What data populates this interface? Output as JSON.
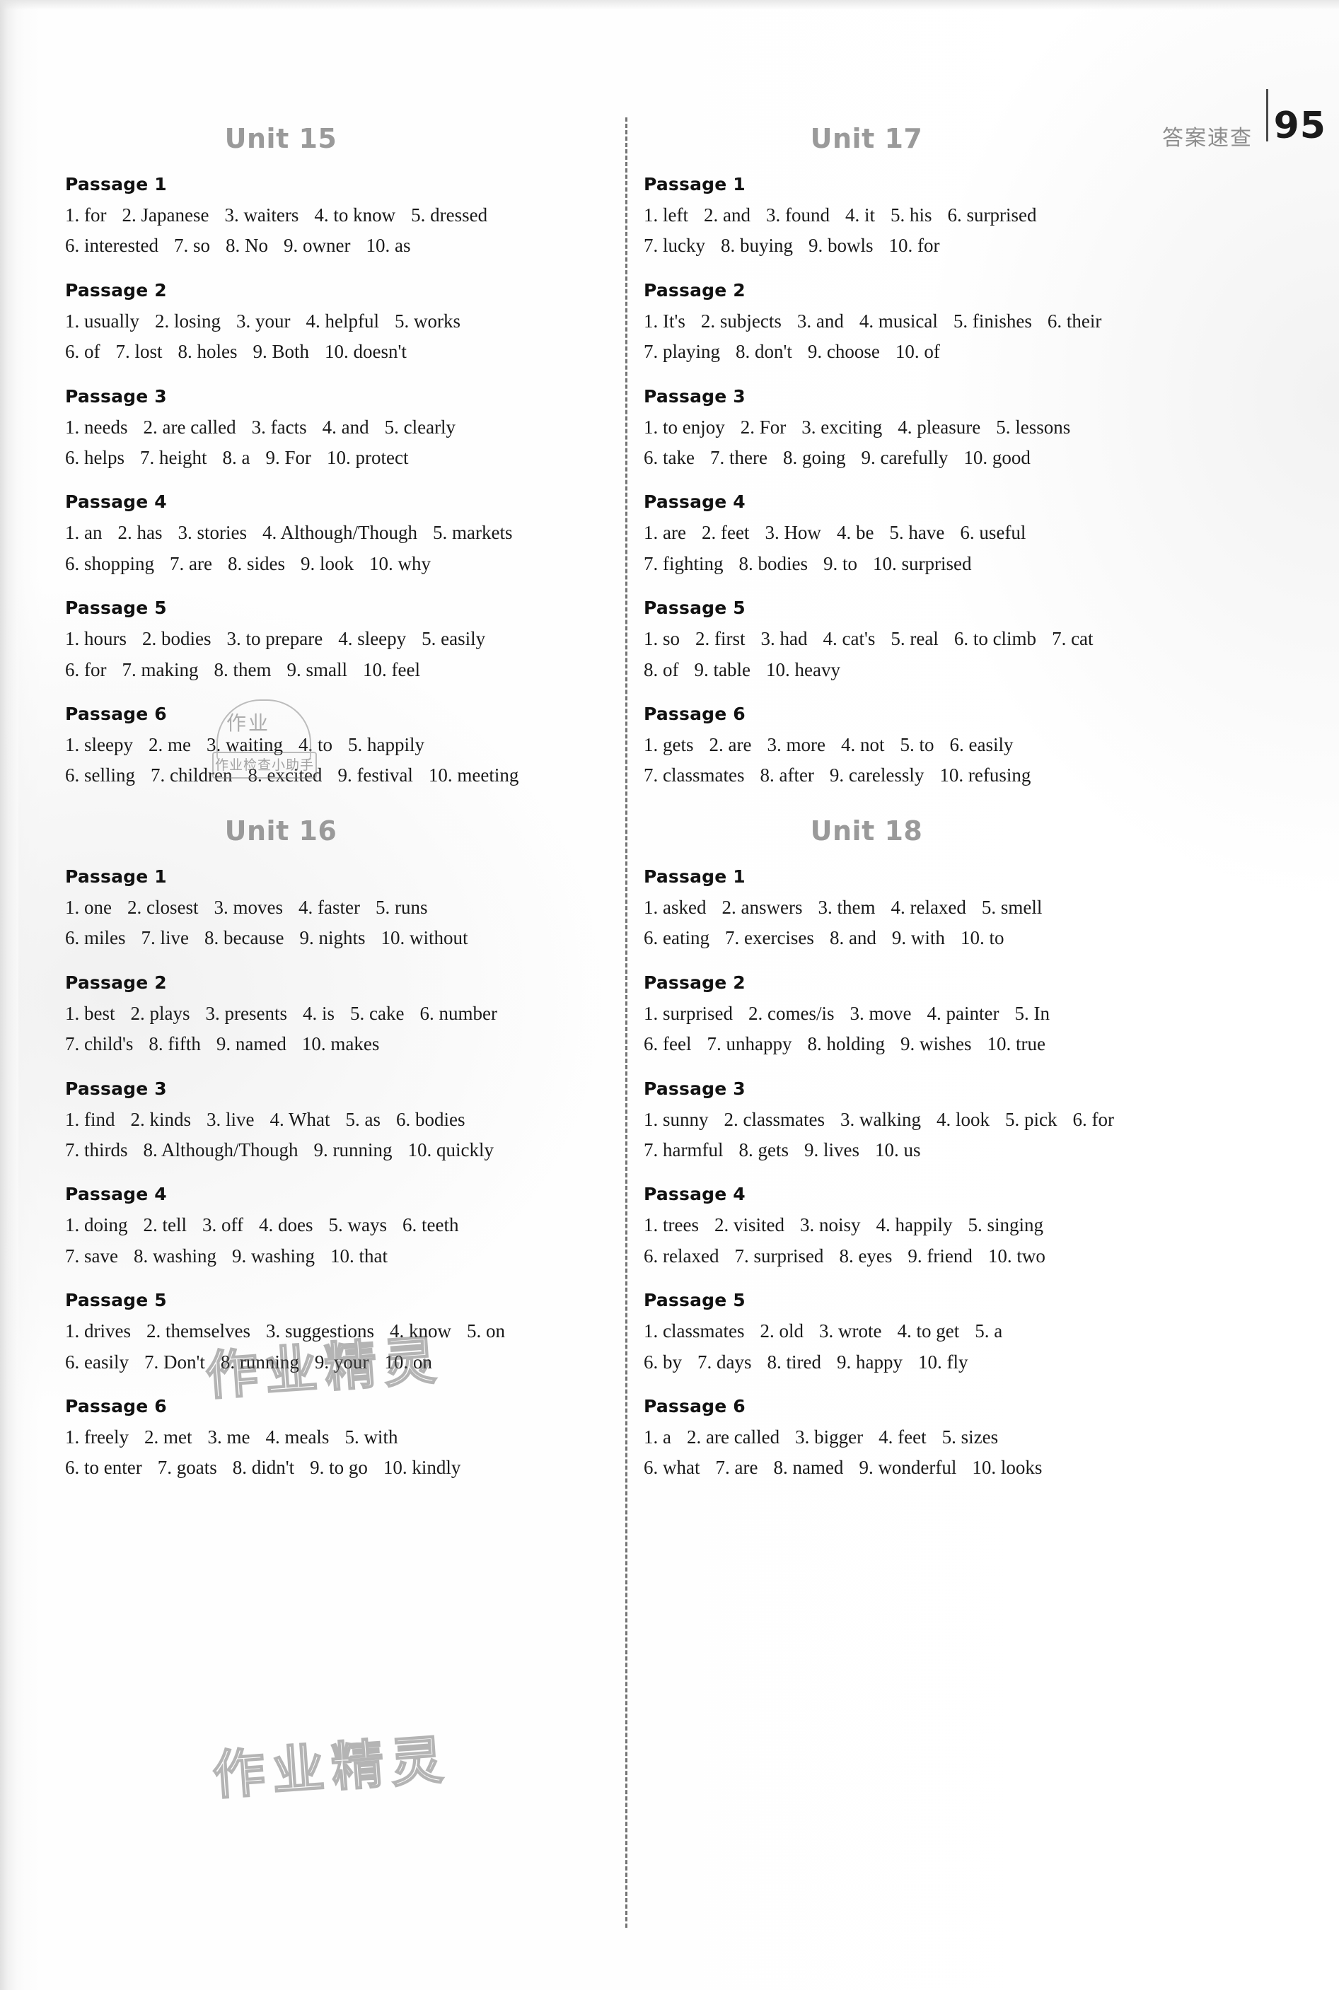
{
  "header": {
    "section_label": "答案速查",
    "page_number": "95"
  },
  "watermarks": {
    "text_a": "作业精灵",
    "text_b": "作业精灵",
    "stamp_big": "作业",
    "stamp_small": "作业检查小助手"
  },
  "columns": [
    {
      "units": [
        {
          "title": "Unit 15",
          "passages": [
            {
              "title": "Passage 1",
              "lines": [
                [
                  "1. for",
                  "2. Japanese",
                  "3. waiters",
                  "4. to know",
                  "5. dressed"
                ],
                [
                  "6. interested",
                  "7. so",
                  "8. No",
                  "9. owner",
                  "10. as"
                ]
              ]
            },
            {
              "title": "Passage 2",
              "lines": [
                [
                  "1. usually",
                  "2. losing",
                  "3. your",
                  "4. helpful",
                  "5. works"
                ],
                [
                  "6. of",
                  "7. lost",
                  "8. holes",
                  "9. Both",
                  "10. doesn't"
                ]
              ]
            },
            {
              "title": "Passage 3",
              "lines": [
                [
                  "1. needs",
                  "2. are called",
                  "3. facts",
                  "4. and",
                  "5. clearly"
                ],
                [
                  "6. helps",
                  "7. height",
                  "8. a",
                  "9. For",
                  "10. protect"
                ]
              ]
            },
            {
              "title": "Passage 4",
              "lines": [
                [
                  "1. an",
                  "2. has",
                  "3. stories",
                  "4. Although/Though",
                  "5. markets"
                ],
                [
                  "6. shopping",
                  "7. are",
                  "8. sides",
                  "9. look",
                  "10. why"
                ]
              ]
            },
            {
              "title": "Passage 5",
              "lines": [
                [
                  "1. hours",
                  "2. bodies",
                  "3. to prepare",
                  "4. sleepy",
                  "5. easily"
                ],
                [
                  "6. for",
                  "7. making",
                  "8. them",
                  "9. small",
                  "10. feel"
                ]
              ]
            },
            {
              "title": "Passage 6",
              "lines": [
                [
                  "1. sleepy",
                  "2. me",
                  "3. waiting",
                  "4. to",
                  "5. happily"
                ],
                [
                  "6. selling",
                  "7. children",
                  "8. excited",
                  "9. festival",
                  "10. meeting"
                ]
              ]
            }
          ]
        },
        {
          "title": "Unit 16",
          "passages": [
            {
              "title": "Passage 1",
              "lines": [
                [
                  "1. one",
                  "2. closest",
                  "3. moves",
                  "4. faster",
                  "5. runs"
                ],
                [
                  "6. miles",
                  "7. live",
                  "8. because",
                  "9. nights",
                  "10. without"
                ]
              ]
            },
            {
              "title": "Passage 2",
              "lines": [
                [
                  "1. best",
                  "2. plays",
                  "3. presents",
                  "4. is",
                  "5. cake",
                  "6. number"
                ],
                [
                  "7. child's",
                  "8. fifth",
                  "9. named",
                  "10. makes"
                ]
              ]
            },
            {
              "title": "Passage 3",
              "lines": [
                [
                  "1. find",
                  "2. kinds",
                  "3. live",
                  "4. What",
                  "5. as",
                  "6. bodies"
                ],
                [
                  "7. thirds",
                  "8. Although/Though",
                  "9. running",
                  "10. quickly"
                ]
              ]
            },
            {
              "title": "Passage 4",
              "lines": [
                [
                  "1. doing",
                  "2. tell",
                  "3. off",
                  "4. does",
                  "5. ways",
                  "6. teeth"
                ],
                [
                  "7. save",
                  "8. washing",
                  "9. washing",
                  "10. that"
                ]
              ]
            },
            {
              "title": "Passage 5",
              "lines": [
                [
                  "1. drives",
                  "2. themselves",
                  "3. suggestions",
                  "4. know",
                  "5. on"
                ],
                [
                  "6. easily",
                  "7. Don't",
                  "8. running",
                  "9. your",
                  "10. on"
                ]
              ]
            },
            {
              "title": "Passage 6",
              "lines": [
                [
                  "1. freely",
                  "2. met",
                  "3. me",
                  "4. meals",
                  "5. with"
                ],
                [
                  "6. to enter",
                  "7. goats",
                  "8. didn't",
                  "9. to go",
                  "10. kindly"
                ]
              ]
            }
          ]
        }
      ]
    },
    {
      "units": [
        {
          "title": "Unit 17",
          "passages": [
            {
              "title": "Passage 1",
              "lines": [
                [
                  "1. left",
                  "2. and",
                  "3. found",
                  "4. it",
                  "5. his",
                  "6. surprised"
                ],
                [
                  "7. lucky",
                  "8. buying",
                  "9. bowls",
                  "10. for"
                ]
              ]
            },
            {
              "title": "Passage 2",
              "lines": [
                [
                  "1. It's",
                  "2. subjects",
                  "3. and",
                  "4. musical",
                  "5. finishes",
                  "6. their"
                ],
                [
                  "7. playing",
                  "8. don't",
                  "9. choose",
                  "10. of"
                ]
              ]
            },
            {
              "title": "Passage 3",
              "lines": [
                [
                  "1. to enjoy",
                  "2. For",
                  "3. exciting",
                  "4. pleasure",
                  "5. lessons"
                ],
                [
                  "6. take",
                  "7. there",
                  "8. going",
                  "9. carefully",
                  "10. good"
                ]
              ]
            },
            {
              "title": "Passage 4",
              "lines": [
                [
                  "1. are",
                  "2. feet",
                  "3. How",
                  "4. be",
                  "5. have",
                  "6. useful"
                ],
                [
                  "7. fighting",
                  "8. bodies",
                  "9. to",
                  "10. surprised"
                ]
              ]
            },
            {
              "title": "Passage 5",
              "lines": [
                [
                  "1. so",
                  "2. first",
                  "3. had",
                  "4. cat's",
                  "5. real",
                  "6. to climb",
                  "7. cat"
                ],
                [
                  "8. of",
                  "9. table",
                  "10. heavy"
                ]
              ]
            },
            {
              "title": "Passage 6",
              "lines": [
                [
                  "1. gets",
                  "2. are",
                  "3. more",
                  "4. not",
                  "5. to",
                  "6. easily"
                ],
                [
                  "7. classmates",
                  "8. after",
                  "9. carelessly",
                  "10. refusing"
                ]
              ]
            }
          ]
        },
        {
          "title": "Unit 18",
          "passages": [
            {
              "title": "Passage 1",
              "lines": [
                [
                  "1. asked",
                  "2. answers",
                  "3. them",
                  "4. relaxed",
                  "5. smell"
                ],
                [
                  "6. eating",
                  "7. exercises",
                  "8. and",
                  "9. with",
                  "10. to"
                ]
              ]
            },
            {
              "title": "Passage 2",
              "lines": [
                [
                  "1. surprised",
                  "2. comes/is",
                  "3. move",
                  "4. painter",
                  "5. In"
                ],
                [
                  "6. feel",
                  "7. unhappy",
                  "8. holding",
                  "9. wishes",
                  "10. true"
                ]
              ]
            },
            {
              "title": "Passage 3",
              "lines": [
                [
                  "1. sunny",
                  "2. classmates",
                  "3. walking",
                  "4. look",
                  "5. pick",
                  "6. for"
                ],
                [
                  "7. harmful",
                  "8. gets",
                  "9. lives",
                  "10. us"
                ]
              ]
            },
            {
              "title": "Passage 4",
              "lines": [
                [
                  "1. trees",
                  "2. visited",
                  "3. noisy",
                  "4. happily",
                  "5. singing"
                ],
                [
                  "6. relaxed",
                  "7. surprised",
                  "8. eyes",
                  "9. friend",
                  "10. two"
                ]
              ]
            },
            {
              "title": "Passage 5",
              "lines": [
                [
                  "1. classmates",
                  "2. old",
                  "3. wrote",
                  "4. to get",
                  "5. a"
                ],
                [
                  "6. by",
                  "7. days",
                  "8. tired",
                  "9. happy",
                  "10. fly"
                ]
              ]
            },
            {
              "title": "Passage 6",
              "lines": [
                [
                  "1. a",
                  "2. are called",
                  "3. bigger",
                  "4. feet",
                  "5. sizes"
                ],
                [
                  "6. what",
                  "7. are",
                  "8. named",
                  "9. wonderful",
                  "10. looks"
                ]
              ]
            }
          ]
        }
      ]
    }
  ]
}
